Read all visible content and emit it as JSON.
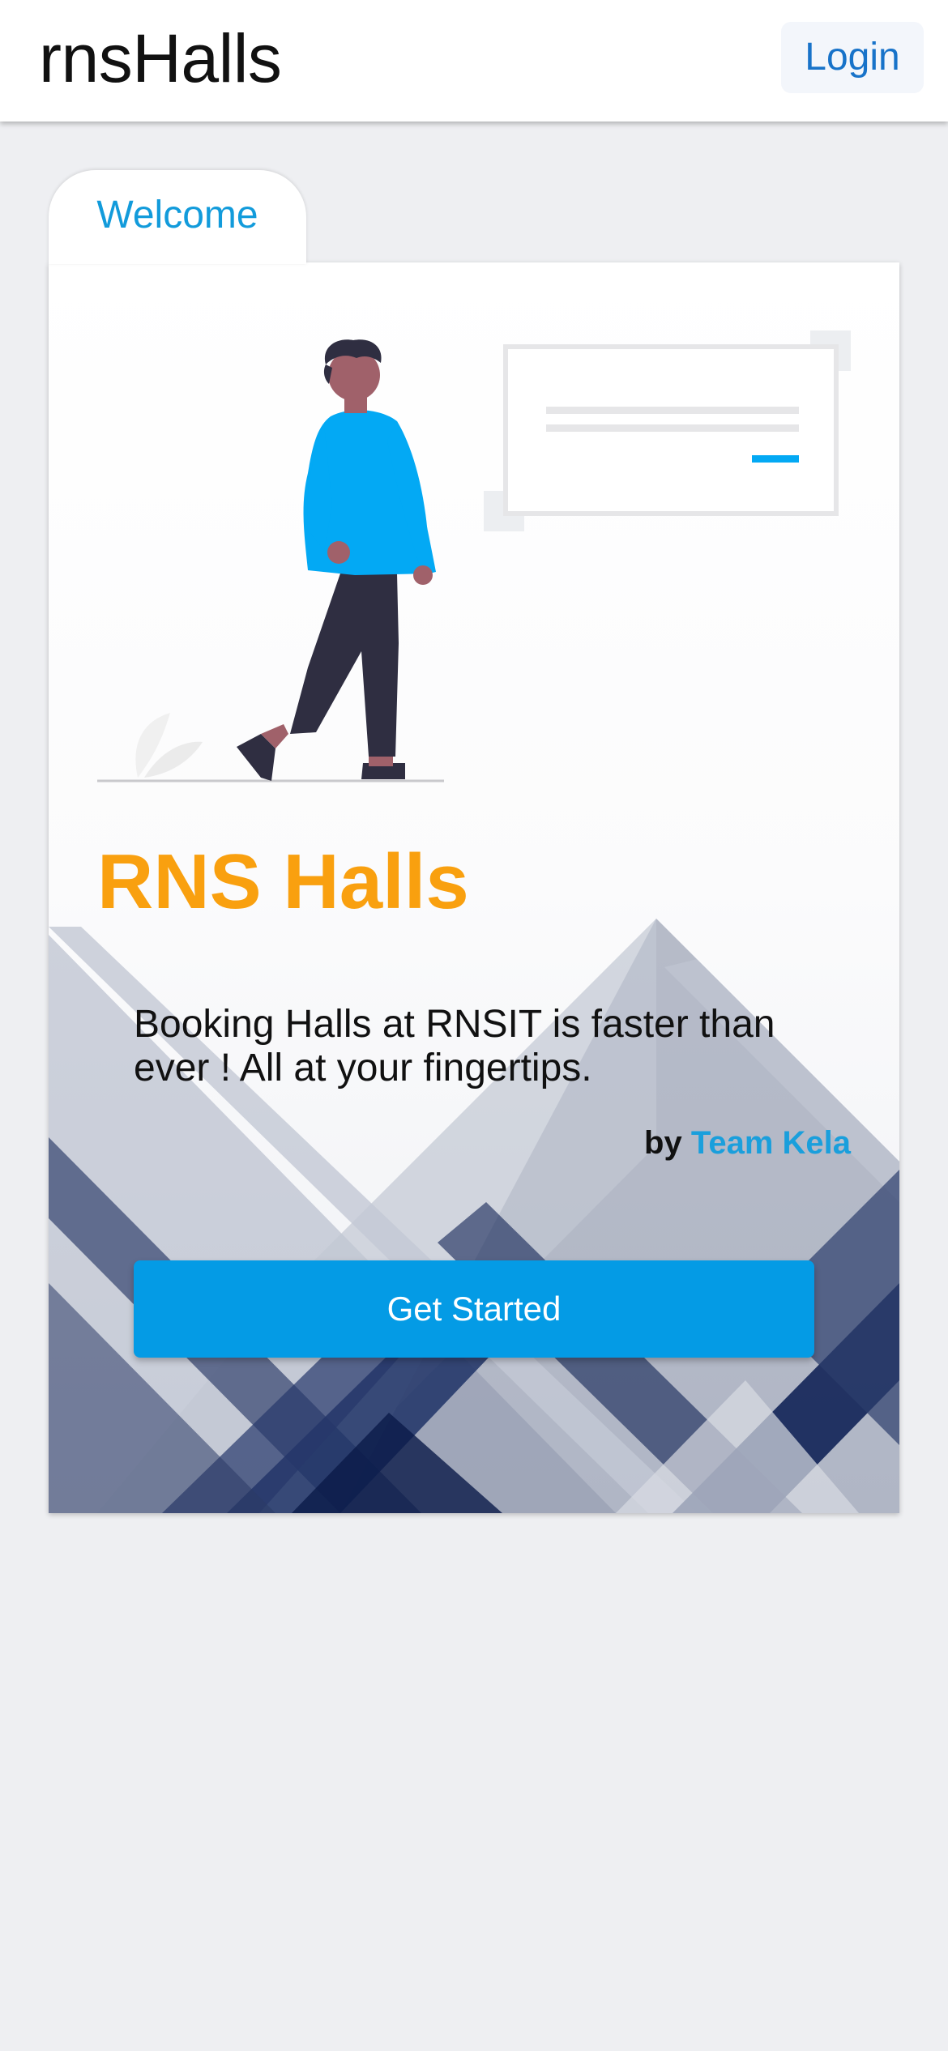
{
  "header": {
    "brand": "rnsHalls",
    "login_label": "Login"
  },
  "tabs": {
    "welcome_label": "Welcome"
  },
  "hero": {
    "title": "RNS Halls",
    "tagline": "Booking Halls at RNSIT is faster than ever ! All at your fingertips.",
    "credit_prefix": "by",
    "credit_team": "Team Kela",
    "cta_label": "Get Started",
    "illustration": "person-walking-illustration"
  },
  "colors": {
    "title_orange": "#f9a00f",
    "accent_blue": "#049be5",
    "link_blue": "#1873c9",
    "background": "#eeeff2"
  }
}
